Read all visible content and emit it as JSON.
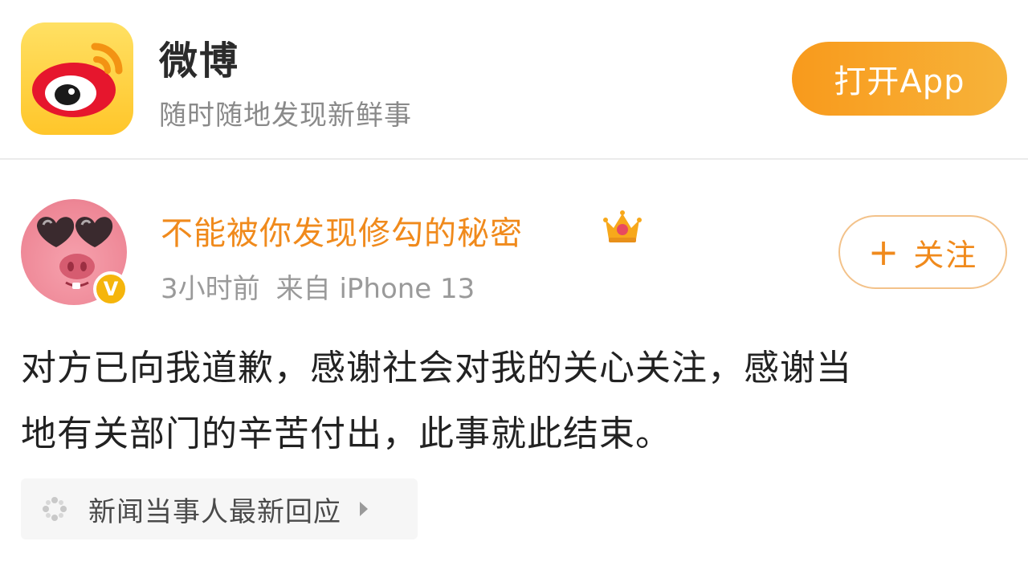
{
  "banner": {
    "app_name": "微博",
    "slogan": "随时随地发现新鲜事",
    "open_button": "打开App",
    "icon": "weibo-logo-icon"
  },
  "post": {
    "username": "不能被你发现修勾的秘密",
    "user_badge_icon": "crown-icon",
    "verified_mark": "V",
    "time": "3小时前",
    "source": "来自 iPhone 13",
    "follow_button": {
      "icon": "plus-icon",
      "plus": "+",
      "label": "关注"
    },
    "text_lines": [
      "对方已向我道歉，感谢社会对我的关心关注，感谢当",
      "地有关部门的辛苦付出，此事就此结束。"
    ],
    "topic": {
      "icon": "sparkle-icon",
      "label": "新闻当事人最新回应"
    }
  },
  "colors": {
    "brand_orange": "#f08a1c",
    "button_gradient_start": "#f89a1c",
    "icon_yellow": "#ffc62a",
    "weibo_red": "#e6162d",
    "meta_gray": "#9a9a9a"
  }
}
